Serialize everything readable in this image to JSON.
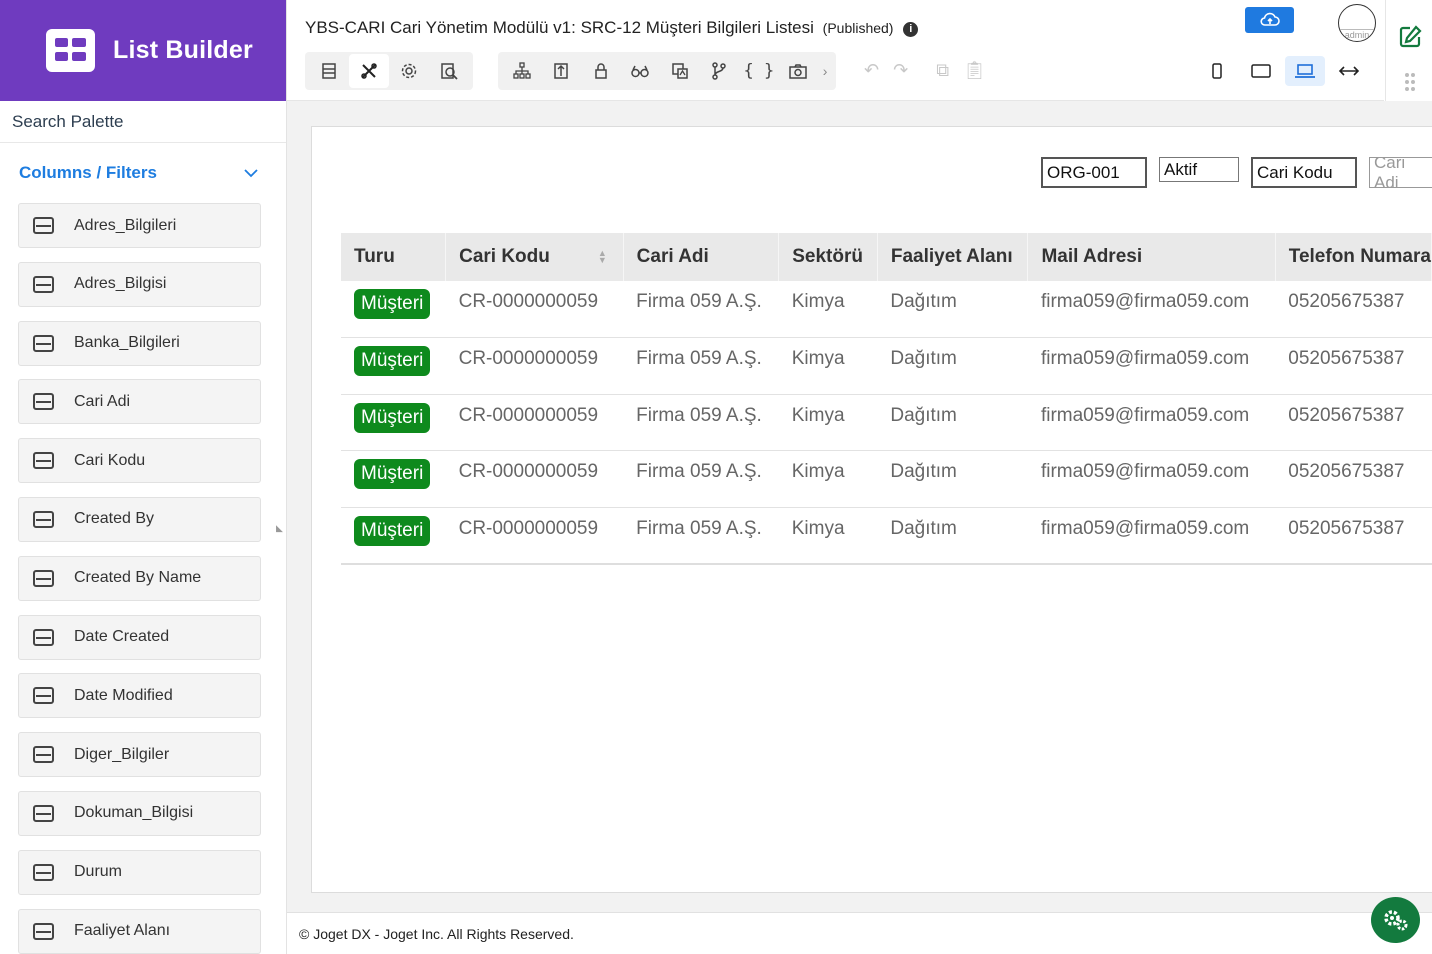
{
  "brand": {
    "title": "List Builder"
  },
  "sidebar": {
    "search_label": "Search Palette",
    "section_title": "Columns / Filters",
    "items": [
      {
        "label": "Adres_Bilgileri"
      },
      {
        "label": "Adres_Bilgisi"
      },
      {
        "label": "Banka_Bilgileri"
      },
      {
        "label": "Cari Adi"
      },
      {
        "label": "Cari Kodu"
      },
      {
        "label": "Created By"
      },
      {
        "label": "Created By Name"
      },
      {
        "label": "Date Created"
      },
      {
        "label": "Date Modified"
      },
      {
        "label": "Diger_Bilgiler"
      },
      {
        "label": "Dokuman_Bilgisi"
      },
      {
        "label": "Durum"
      },
      {
        "label": "Faaliyet Alanı"
      }
    ]
  },
  "header": {
    "title": "YBS-CARI Cari Yönetim Modülü v1: SRC-12 Müşteri Bilgileri Listesi",
    "status": "(Published)",
    "avatar_text": "admin"
  },
  "filters": {
    "org": "ORG-001",
    "status": "Aktif",
    "cari_kodu": "Cari Kodu",
    "cari_adi_placeholder": "Cari Adi"
  },
  "table": {
    "columns": [
      "Turu",
      "Cari Kodu",
      "Cari Adi",
      "Sektörü",
      "Faaliyet Alanı",
      "Mail Adresi",
      "Telefon Numara"
    ],
    "rows": [
      {
        "turu": "Müşteri",
        "cari_kodu": "CR-0000000059",
        "cari_adi": "Firma 059 A.Ş.",
        "sektor": "Kimya",
        "faaliyet": "Dağıtım",
        "mail": "firma059@firma059.com",
        "telefon": "05205675387"
      },
      {
        "turu": "Müşteri",
        "cari_kodu": "CR-0000000059",
        "cari_adi": "Firma 059 A.Ş.",
        "sektor": "Kimya",
        "faaliyet": "Dağıtım",
        "mail": "firma059@firma059.com",
        "telefon": "05205675387"
      },
      {
        "turu": "Müşteri",
        "cari_kodu": "CR-0000000059",
        "cari_adi": "Firma 059 A.Ş.",
        "sektor": "Kimya",
        "faaliyet": "Dağıtım",
        "mail": "firma059@firma059.com",
        "telefon": "05205675387"
      },
      {
        "turu": "Müşteri",
        "cari_kodu": "CR-0000000059",
        "cari_adi": "Firma 059 A.Ş.",
        "sektor": "Kimya",
        "faaliyet": "Dağıtım",
        "mail": "firma059@firma059.com",
        "telefon": "05205675387"
      },
      {
        "turu": "Müşteri",
        "cari_kodu": "CR-0000000059",
        "cari_adi": "Firma 059 A.Ş.",
        "sektor": "Kimya",
        "faaliyet": "Dağıtım",
        "mail": "firma059@firma059.com",
        "telefon": "05205675387"
      }
    ]
  },
  "footer": {
    "text": "© Joget DX - Joget Inc. All Rights Reserved."
  },
  "colors": {
    "brand": "#6f3bbf",
    "accent": "#1e7de0",
    "badge": "#0e8a1d",
    "fab": "#137a3e"
  },
  "icons": {
    "toolbar_main": [
      "list-icon",
      "tools-icon",
      "gear-icon",
      "preview-icon"
    ],
    "toolbar_props": [
      "hierarchy-icon",
      "binder-icon",
      "lock-icon",
      "glasses-icon",
      "translate-icon",
      "branch-icon",
      "json-icon",
      "camera-icon"
    ],
    "edit": [
      "undo-icon",
      "redo-icon",
      "copy-icon",
      "paste-icon"
    ],
    "devices": [
      "phone-icon",
      "tablet-icon",
      "laptop-icon",
      "expand-icon"
    ]
  }
}
